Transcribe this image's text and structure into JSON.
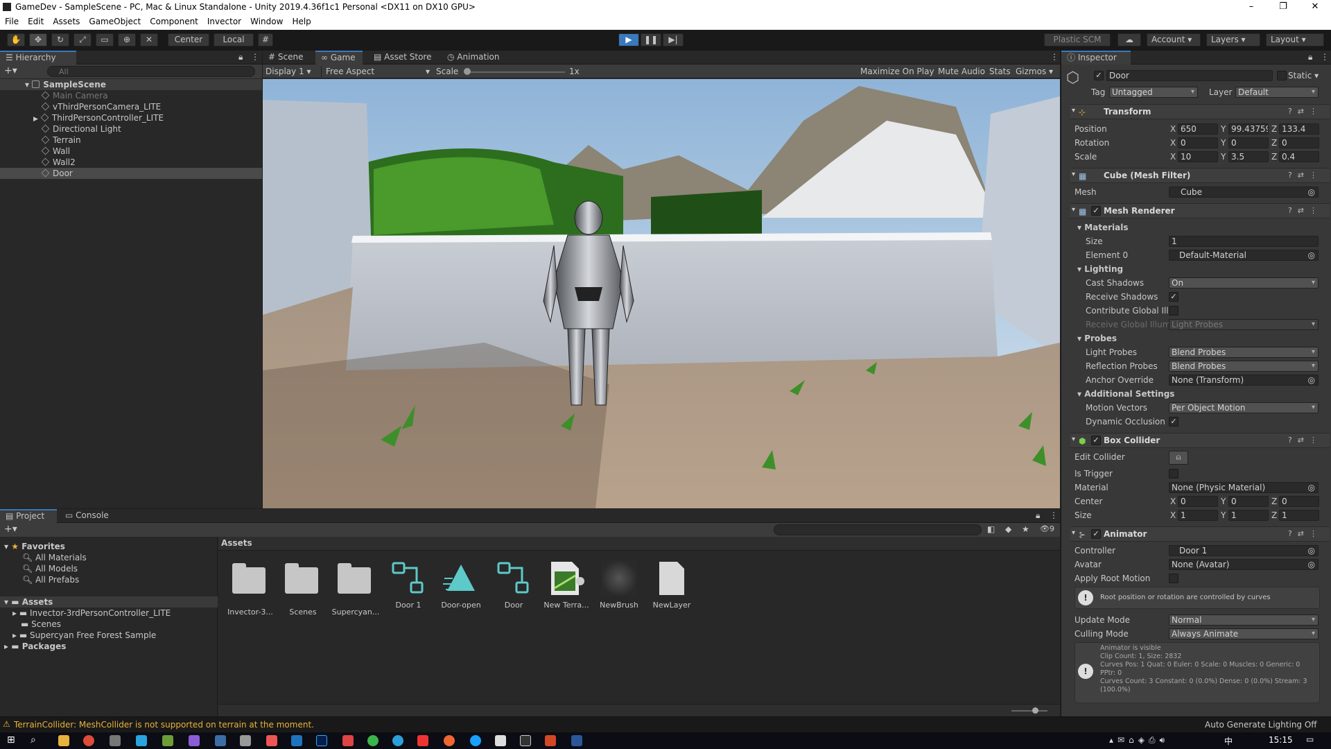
{
  "window": {
    "title": "GameDev - SampleScene - PC, Mac & Linux Standalone - Unity 2019.4.36f1c1 Personal <DX11 on DX10 GPU>",
    "minimize": "–",
    "maximize": "❐",
    "close": "✕"
  },
  "menu": [
    "File",
    "Edit",
    "Assets",
    "GameObject",
    "Component",
    "Invector",
    "Window",
    "Help"
  ],
  "toolbar": {
    "center_label": "Center",
    "local_label": "Local",
    "plastic_label": "Plastic SCM",
    "account_label": "Account",
    "layers_label": "Layers",
    "layout_label": "Layout"
  },
  "hierarchy": {
    "tab_label": "Hierarchy",
    "search_placeholder": "All",
    "scene_name": "SampleScene",
    "items": [
      "Main Camera",
      "vThirdPersonCamera_LITE",
      "ThirdPersonController_LITE",
      "Directional Light",
      "Terrain",
      "Wall",
      "Wall2",
      "Door"
    ]
  },
  "game_view": {
    "tabs": [
      "Scene",
      "Game",
      "Asset Store",
      "Animation"
    ],
    "display": "Display 1",
    "aspect": "Free Aspect",
    "scale_label": "Scale",
    "scale_value": "1x",
    "maximize_on_play": "Maximize On Play",
    "mute_audio": "Mute Audio",
    "stats": "Stats",
    "gizmos": "Gizmos"
  },
  "project": {
    "tabs": [
      "Project",
      "Console"
    ],
    "favorites_label": "Favorites",
    "favorites": [
      "All Materials",
      "All Models",
      "All Prefabs"
    ],
    "assets_label": "Assets",
    "asset_folders": [
      "Invector-3rdPersonController_LITE",
      "Scenes",
      "Supercyan Free Forest Sample"
    ],
    "packages_label": "Packages",
    "breadcrumb": "Assets",
    "hidden_count": "9",
    "grid": [
      {
        "label": "Invector-3...",
        "icon": "folder"
      },
      {
        "label": "Scenes",
        "icon": "folder"
      },
      {
        "label": "Supercyan...",
        "icon": "folder"
      },
      {
        "label": "Door 1",
        "icon": "animator-controller"
      },
      {
        "label": "Door-open",
        "icon": "animation-clip"
      },
      {
        "label": "Door",
        "icon": "animator-controller"
      },
      {
        "label": "New Terra...",
        "icon": "terrain-data"
      },
      {
        "label": "NewBrush",
        "icon": "brush"
      },
      {
        "label": "NewLayer",
        "icon": "file"
      }
    ]
  },
  "status": {
    "warning": "TerrainCollider: MeshCollider is not supported on terrain at the moment.",
    "lighting": "Auto Generate Lighting Off"
  },
  "inspector": {
    "tab_label": "Inspector",
    "object_name": "Door",
    "static_label": "Static",
    "tag_label": "Tag",
    "tag_value": "Untagged",
    "layer_label": "Layer",
    "layer_value": "Default",
    "transform": {
      "title": "Transform",
      "position_label": "Position",
      "position": [
        "650",
        "99.43759",
        "133.4"
      ],
      "rotation_label": "Rotation",
      "rotation": [
        "0",
        "0",
        "0"
      ],
      "scale_label": "Scale",
      "scale": [
        "10",
        "3.5",
        "0.4"
      ]
    },
    "mesh_filter": {
      "title": "Cube (Mesh Filter)",
      "mesh_label": "Mesh",
      "mesh_value": "Cube"
    },
    "mesh_renderer": {
      "title": "Mesh Renderer",
      "materials_label": "Materials",
      "size_label": "Size",
      "size_value": "1",
      "element_label": "Element 0",
      "element_value": "Default-Material",
      "lighting_label": "Lighting",
      "cast_shadows_label": "Cast Shadows",
      "cast_shadows_value": "On",
      "receive_shadows_label": "Receive Shadows",
      "contribute_gi_label": "Contribute Global Illu",
      "receive_gi_label": "Receive Global Illumi",
      "receive_gi_value": "Light Probes",
      "probes_label": "Probes",
      "light_probes_label": "Light Probes",
      "light_probes_value": "Blend Probes",
      "reflection_probes_label": "Reflection Probes",
      "reflection_probes_value": "Blend Probes",
      "anchor_label": "Anchor Override",
      "anchor_value": "None (Transform)",
      "additional_label": "Additional Settings",
      "motion_vectors_label": "Motion Vectors",
      "motion_vectors_value": "Per Object Motion",
      "dynamic_occlusion_label": "Dynamic Occlusion"
    },
    "box_collider": {
      "title": "Box Collider",
      "edit_label": "Edit Collider",
      "trigger_label": "Is Trigger",
      "material_label": "Material",
      "material_value": "None (Physic Material)",
      "center_label": "Center",
      "center": [
        "0",
        "0",
        "0"
      ],
      "size_label": "Size",
      "size": [
        "1",
        "1",
        "1"
      ]
    },
    "animator": {
      "title": "Animator",
      "controller_label": "Controller",
      "controller_value": "Door 1",
      "avatar_label": "Avatar",
      "avatar_value": "None (Avatar)",
      "root_motion_label": "Apply Root Motion",
      "info": "Root position or rotation are controlled by curves",
      "update_label": "Update Mode",
      "update_value": "Normal",
      "culling_label": "Culling Mode",
      "culling_value": "Always Animate",
      "stats": [
        "Animator is visible",
        "Clip Count: 1, Size: 2832",
        "Curves Pos: 1 Quat: 0 Euler: 0 Scale: 0 Muscles: 0 Generic: 0",
        "PPtr: 0",
        "Curves Count: 3 Constant: 0 (0.0%) Dense: 0 (0.0%) Stream: 3",
        "(100.0%)"
      ]
    }
  },
  "taskbar": {
    "time": "15:15",
    "ime": "中"
  },
  "colors": {
    "accent": "#3a79bb",
    "panel": "#383838",
    "dark": "#191919",
    "warning": "#e8b33c"
  }
}
